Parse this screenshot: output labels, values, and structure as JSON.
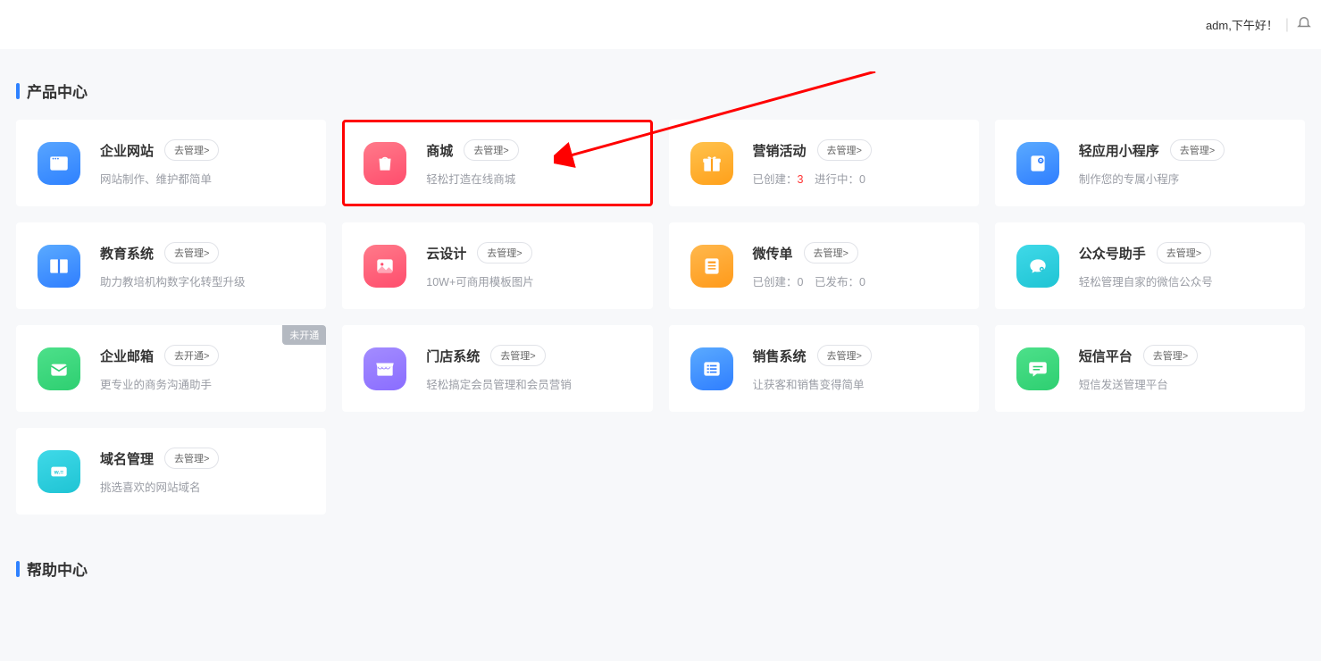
{
  "topbar": {
    "greeting": "adm,下午好！"
  },
  "sections": {
    "product_center": "产品中心",
    "help_center": "帮助中心"
  },
  "cards": [
    {
      "title": "企业网站",
      "btn": "去管理>",
      "desc": "网站制作、维护都简单"
    },
    {
      "title": "商城",
      "btn": "去管理>",
      "desc": "轻松打造在线商城"
    },
    {
      "title": "营销活动",
      "btn": "去管理>",
      "desc_pre": "已创建：",
      "desc_mid": "3",
      "desc_post": "　进行中：0"
    },
    {
      "title": "轻应用小程序",
      "btn": "去管理>",
      "desc": "制作您的专属小程序"
    },
    {
      "title": "教育系统",
      "btn": "去管理>",
      "desc": "助力教培机构数字化转型升级"
    },
    {
      "title": "云设计",
      "btn": "去管理>",
      "desc": "10W+可商用模板图片"
    },
    {
      "title": "微传单",
      "btn": "去管理>",
      "desc": "已创建：0　已发布：0"
    },
    {
      "title": "公众号助手",
      "btn": "去管理>",
      "desc": "轻松管理自家的微信公众号"
    },
    {
      "title": "企业邮箱",
      "btn": "去开通>",
      "desc": "更专业的商务沟通助手",
      "badge": "未开通"
    },
    {
      "title": "门店系统",
      "btn": "去管理>",
      "desc": "轻松搞定会员管理和会员营销"
    },
    {
      "title": "销售系统",
      "btn": "去管理>",
      "desc": "让获客和销售变得简单"
    },
    {
      "title": "短信平台",
      "btn": "去管理>",
      "desc": "短信发送管理平台"
    },
    {
      "title": "域名管理",
      "btn": "去管理>",
      "desc": "挑选喜欢的网站域名"
    }
  ]
}
